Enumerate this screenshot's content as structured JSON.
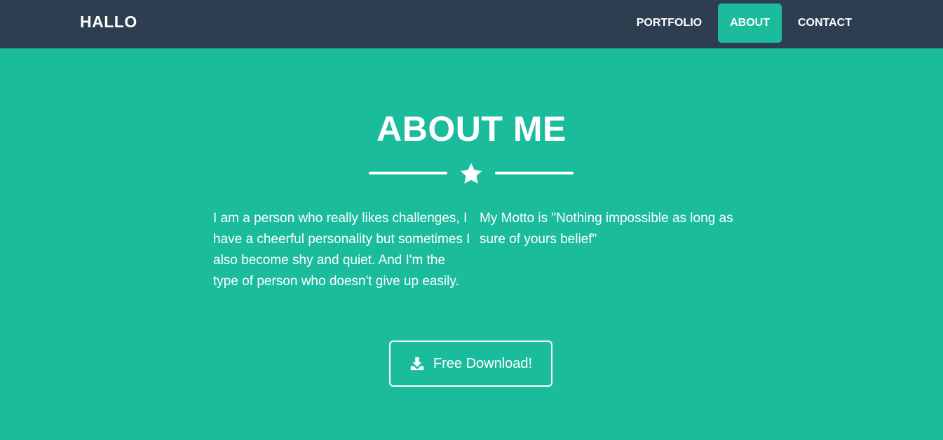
{
  "navbar": {
    "brand": "HALLO",
    "items": [
      {
        "label": "PORTFOLIO",
        "active": false
      },
      {
        "label": "ABOUT",
        "active": true
      },
      {
        "label": "CONTACT",
        "active": false
      }
    ]
  },
  "about": {
    "title": "ABOUT ME",
    "divider_icon": "star-icon",
    "left_text": "I am a person who really likes challenges, I have a cheerful personality but sometimes I also become shy and quiet. And I'm the type of person who doesn't give up easily.",
    "right_text": "My Motto is \"Nothing impossible as long as sure of yours belief\"",
    "button": {
      "label": "Free Download!",
      "icon": "download-icon"
    }
  },
  "colors": {
    "navbar_bg": "#2c3e50",
    "accent": "#1abc9c",
    "text": "#ffffff"
  }
}
